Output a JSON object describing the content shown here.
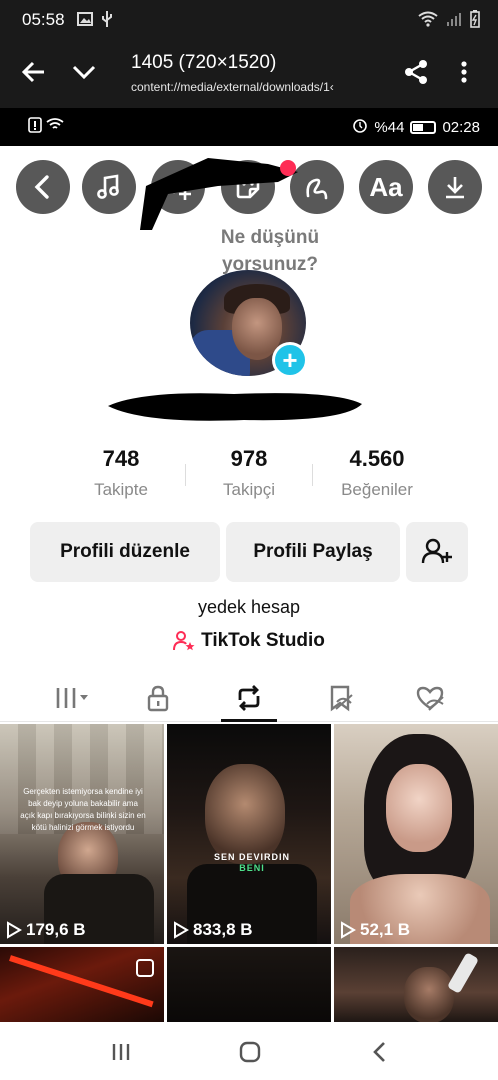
{
  "system_status": {
    "time": "05:58",
    "left_icons": [
      "image-icon",
      "usb-icon"
    ],
    "right_icons": [
      "wifi-icon",
      "signal-icon",
      "battery-icon"
    ]
  },
  "viewer": {
    "title": "1405 (720×1520)",
    "path": "content://media/external/downloads/1‹",
    "icons": [
      "back-arrow-icon",
      "chevron-down-icon",
      "share-icon",
      "more-vert-icon"
    ]
  },
  "inner_status": {
    "time": "02:28",
    "battery": "%44",
    "left_icons": [
      "alert-icon",
      "wifi-icon"
    ],
    "right_icons": [
      "alarm-icon",
      "battery-icon"
    ]
  },
  "editor_tools": [
    {
      "name": "back",
      "icon": "chevron-left-icon"
    },
    {
      "name": "music",
      "icon": "music-note-icon"
    },
    {
      "name": "effects",
      "icon": "sparkles-icon"
    },
    {
      "name": "sticker",
      "icon": "sticker-icon"
    },
    {
      "name": "draw",
      "icon": "squiggle-icon"
    },
    {
      "name": "text",
      "label": "Aa",
      "icon": "text-icon"
    },
    {
      "name": "save",
      "icon": "download-icon"
    }
  ],
  "profile": {
    "thought_bubble": "Ne düşünü yorsunuz?",
    "stats": [
      {
        "value": "748",
        "label": "Takipte"
      },
      {
        "value": "978",
        "label": "Takipçi"
      },
      {
        "value": "4.560",
        "label": "Beğeniler"
      }
    ],
    "buttons": {
      "edit": "Profili düzenle",
      "share": "Profili Paylaş"
    },
    "bio": "yedek hesap",
    "studio_link": "TikTok Studio"
  },
  "tabs": [
    {
      "name": "videos",
      "icon": "grid-icon",
      "active": false
    },
    {
      "name": "private",
      "icon": "lock-icon",
      "active": false
    },
    {
      "name": "reposts",
      "icon": "repost-icon",
      "active": true
    },
    {
      "name": "favorites",
      "icon": "bookmark-hidden-icon",
      "active": false
    },
    {
      "name": "liked",
      "icon": "heart-hidden-icon",
      "active": false
    }
  ],
  "videos": [
    {
      "views": "179,6 B",
      "caption": "Gerçekten istemiyorsa kendine iyi bak deyip yoluna bakabilir ama açık kapı bırakıyorsa bilinki sizin en kötü halinizi görmek istiyordu"
    },
    {
      "views": "833,8 B",
      "overlay": "SEN DEVIRDIN",
      "overlay_accent": "BENI"
    },
    {
      "views": "52,1 B"
    },
    {
      "views": ""
    },
    {
      "views": ""
    },
    {
      "views": ""
    }
  ],
  "colors": {
    "badge_blue": "#20c3e8",
    "studio_pink": "#fe2c55",
    "tool_gray": "#585858"
  }
}
